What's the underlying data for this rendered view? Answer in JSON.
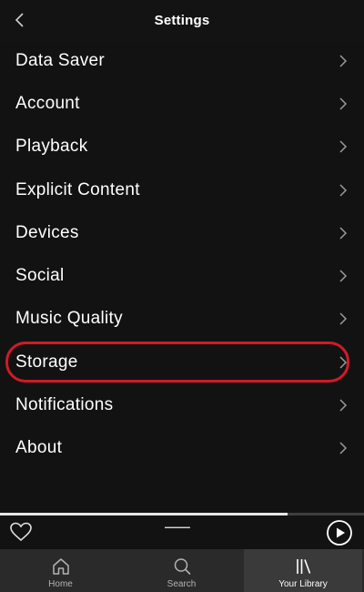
{
  "header": {
    "title": "Settings",
    "back_icon": "chevron-left-icon"
  },
  "menu": {
    "items": [
      {
        "label": "Data Saver"
      },
      {
        "label": "Account"
      },
      {
        "label": "Playback"
      },
      {
        "label": "Explicit Content"
      },
      {
        "label": "Devices"
      },
      {
        "label": "Social"
      },
      {
        "label": "Music Quality"
      },
      {
        "label": "Storage",
        "highlighted": true
      },
      {
        "label": "Notifications"
      },
      {
        "label": "About"
      }
    ],
    "chevron_icon": "chevron-right-icon",
    "highlight_color": "#d11a27"
  },
  "now_playing": {
    "progress_fraction": 0.79,
    "heart_icon": "heart-outline-icon",
    "track_text": "▔▔▔▔▔▔▔ ▔▔▔▔",
    "play_icon": "play-circle-icon"
  },
  "tabbar": {
    "tabs": [
      {
        "label": "Home",
        "icon": "home-icon",
        "active": false
      },
      {
        "label": "Search",
        "icon": "search-icon",
        "active": false
      },
      {
        "label": "Your Library",
        "icon": "library-icon",
        "active": true
      }
    ]
  },
  "colors": {
    "background": "#121212",
    "tabbar": "#2a2a2a",
    "active_tab": "#3a3a3a",
    "text": "#ffffff",
    "muted_text": "#b3b3b3"
  }
}
